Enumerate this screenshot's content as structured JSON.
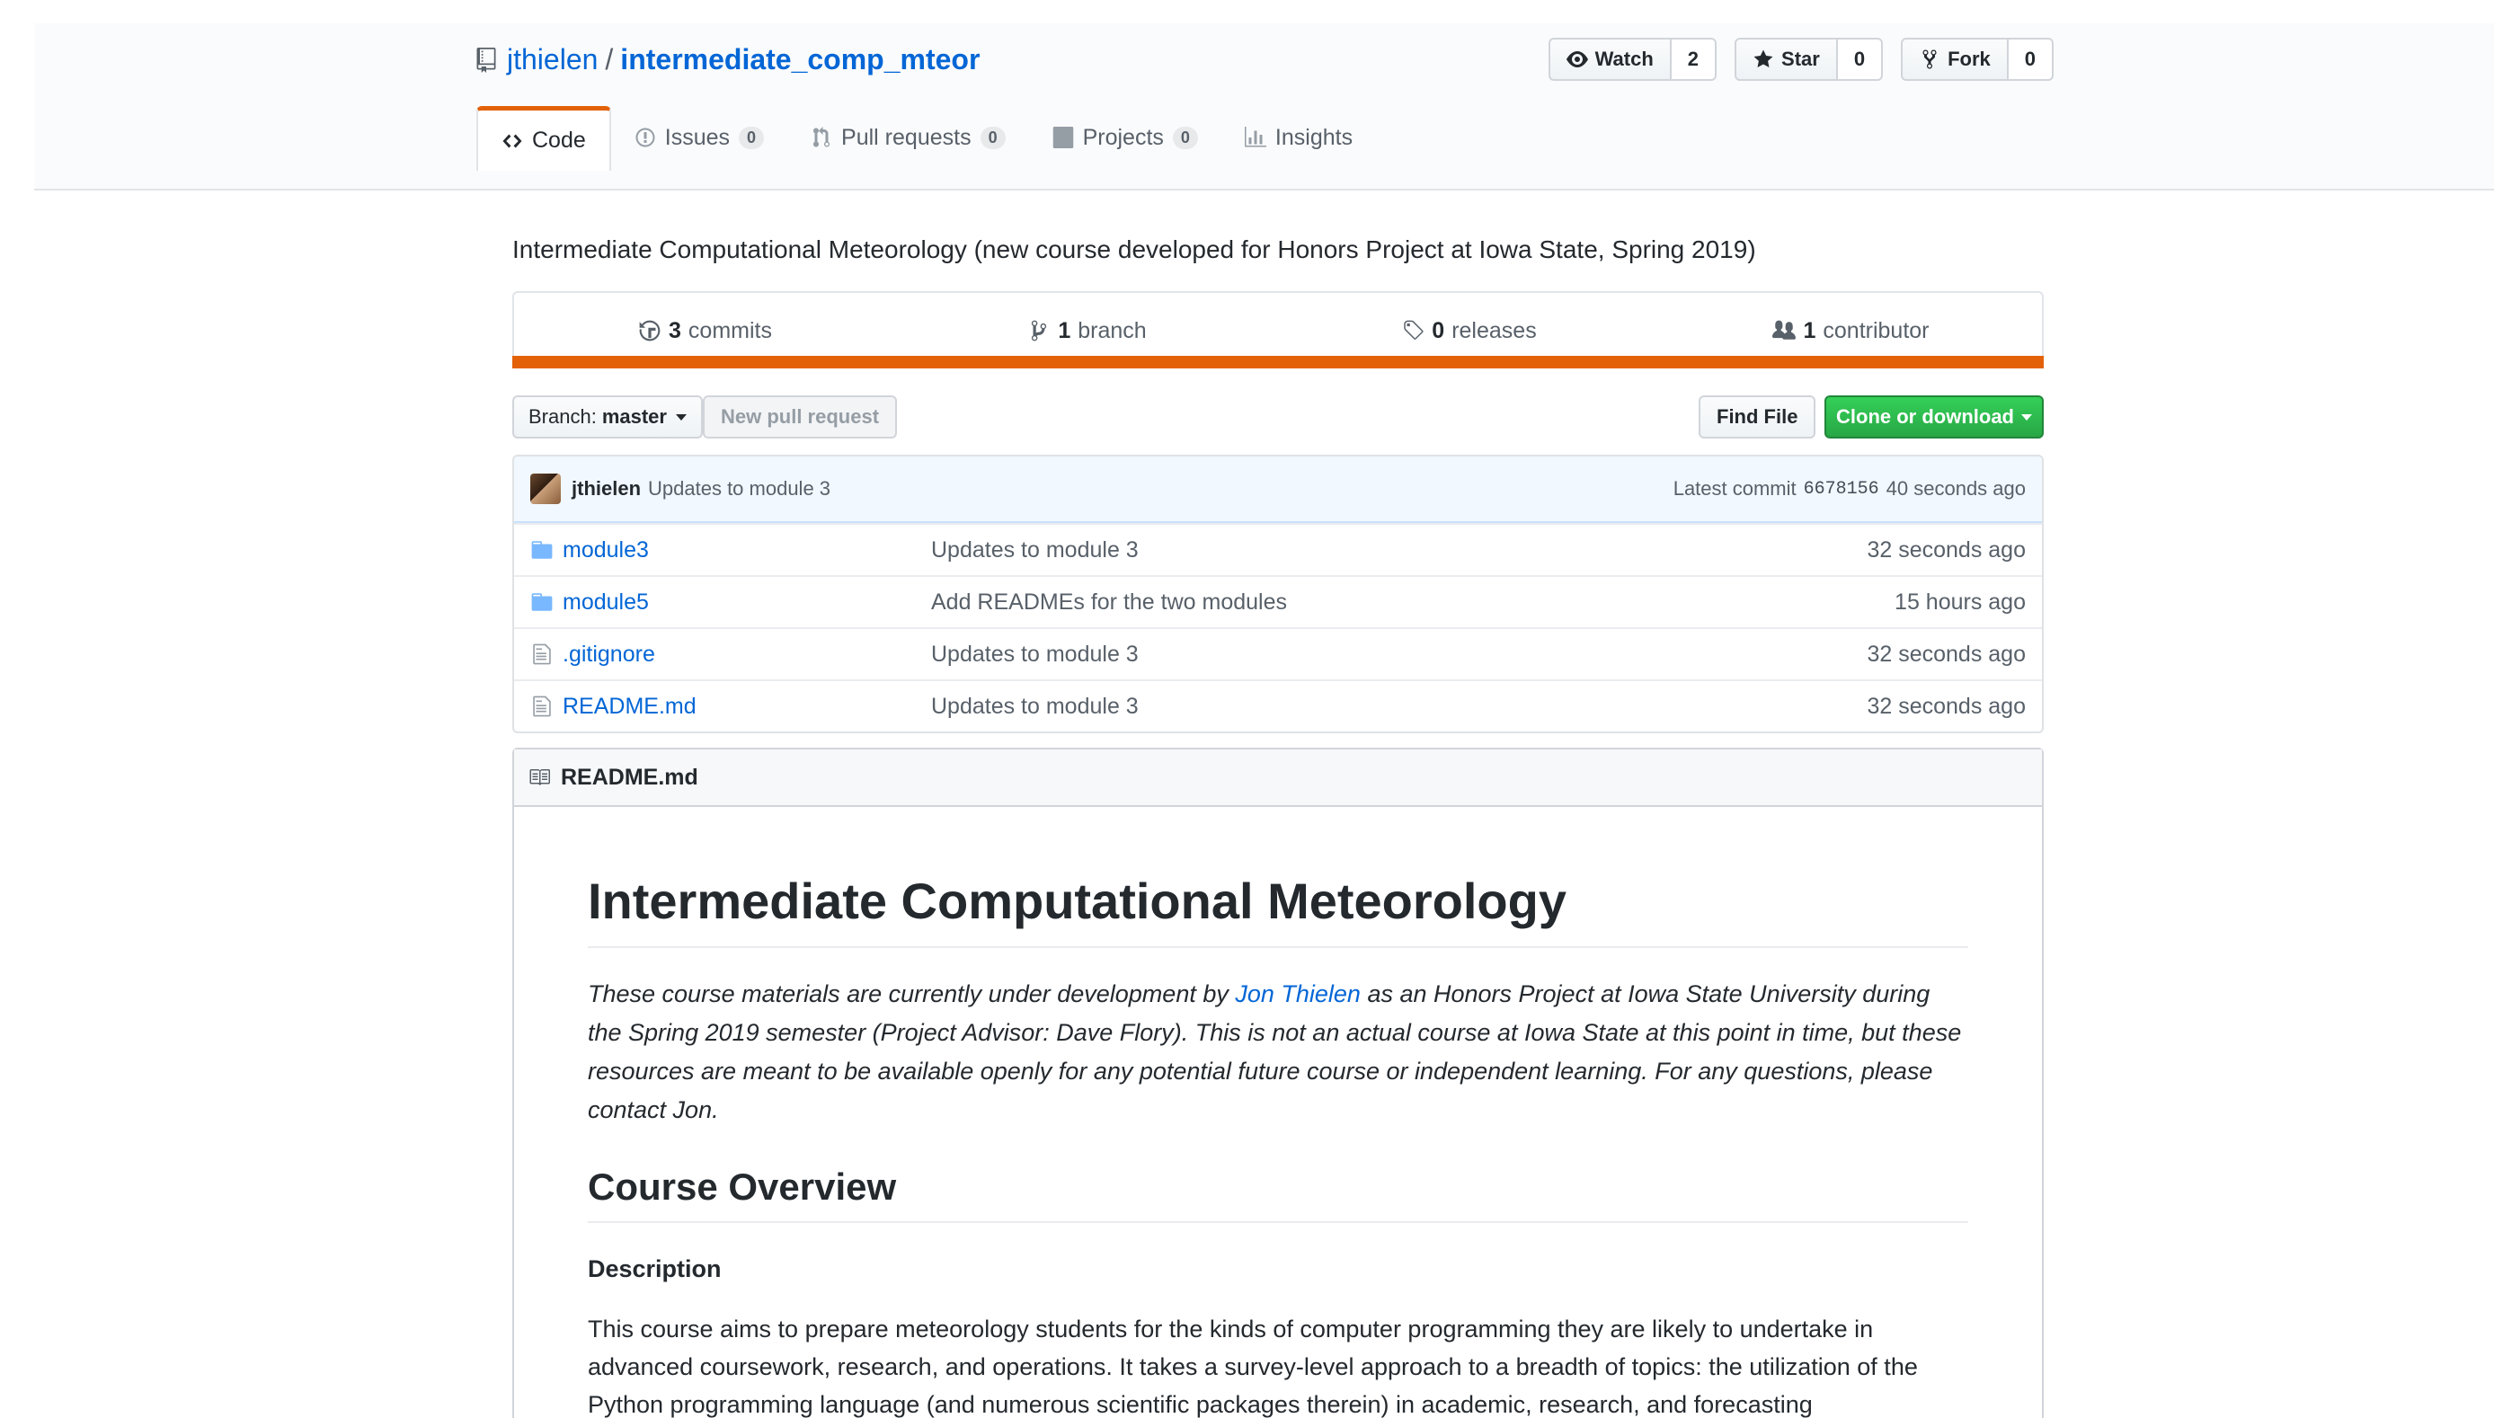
{
  "repo": {
    "owner": "jthielen",
    "separator": "/",
    "name": "intermediate_comp_mteor",
    "description": "Intermediate Computational Meteorology (new course developed for Honors Project at Iowa State, Spring 2019)"
  },
  "actions": {
    "watch": {
      "label": "Watch",
      "count": "2"
    },
    "star": {
      "label": "Star",
      "count": "0"
    },
    "fork": {
      "label": "Fork",
      "count": "0"
    }
  },
  "nav": {
    "code": "Code",
    "issues": {
      "label": "Issues",
      "count": "0"
    },
    "pulls": {
      "label": "Pull requests",
      "count": "0"
    },
    "projects": {
      "label": "Projects",
      "count": "0"
    },
    "insights": "Insights"
  },
  "summary": {
    "commits": {
      "num": "3",
      "label": "commits"
    },
    "branches": {
      "num": "1",
      "label": "branch"
    },
    "releases": {
      "num": "0",
      "label": "releases"
    },
    "contributors": {
      "num": "1",
      "label": "contributor"
    },
    "language_color": "#e36209"
  },
  "filenav": {
    "branch_prefix": "Branch:",
    "branch_name": "master",
    "new_pr": "New pull request",
    "find_file": "Find File",
    "clone": "Clone or download"
  },
  "latest_commit": {
    "author": "jthielen",
    "message": "Updates to module 3",
    "prefix": "Latest commit",
    "sha": "6678156",
    "age": "40 seconds ago"
  },
  "files": [
    {
      "name": "module3",
      "type": "dir",
      "message": "Updates to module 3",
      "age": "32 seconds ago"
    },
    {
      "name": "module5",
      "type": "dir",
      "message": "Add READMEs for the two modules",
      "age": "15 hours ago"
    },
    {
      "name": ".gitignore",
      "type": "file",
      "message": "Updates to module 3",
      "age": "32 seconds ago"
    },
    {
      "name": "README.md",
      "type": "file",
      "message": "Updates to module 3",
      "age": "32 seconds ago"
    }
  ],
  "readme": {
    "filename": "README.md",
    "h1": "Intermediate Computational Meteorology",
    "intro_before": "These course materials are currently under development by ",
    "intro_link": "Jon Thielen",
    "intro_after": " as an Honors Project at Iowa State University during the Spring 2019 semester (Project Advisor: Dave Flory). This is not an actual course at Iowa State at this point in time, but these resources are meant to be available openly for any potential future course or independent learning. For any questions, please contact Jon.",
    "h2": "Course Overview",
    "h3": "Description",
    "description": "This course aims to prepare meteorology students for the kinds of computer programming they are likely to undertake in advanced coursework, research, and operations. It takes a survey-level approach to a breadth of topics: the utilization of the Python programming language (and numerous scientific packages therein) in academic, research, and forecasting"
  }
}
